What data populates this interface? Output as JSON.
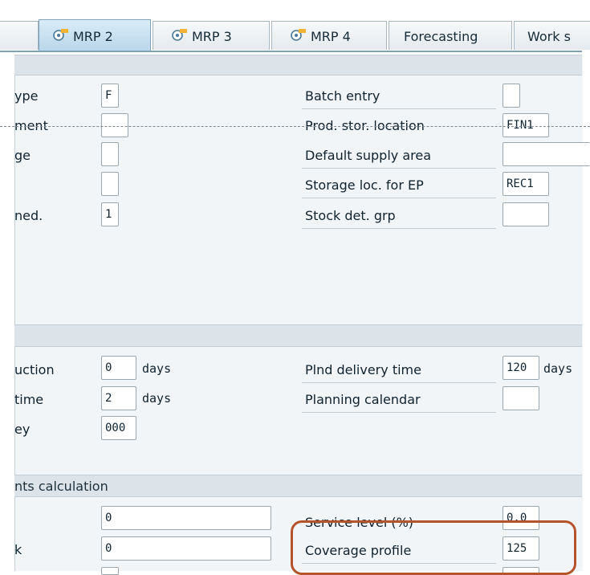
{
  "tabs": [
    {
      "label": "MRP 2",
      "icon": "mrp-icon",
      "active": true
    },
    {
      "label": "MRP 3",
      "icon": "mrp-icon",
      "active": false
    },
    {
      "label": "MRP 4",
      "icon": "mrp-icon",
      "active": false
    },
    {
      "label": "Forecasting",
      "icon": "",
      "active": false
    },
    {
      "label": "Work s",
      "icon": "",
      "active": false
    }
  ],
  "procurement": {
    "left": [
      {
        "label": "ype",
        "value": "F"
      },
      {
        "label": "ment",
        "value": ""
      },
      {
        "label": "ge",
        "value": ""
      },
      {
        "label": "",
        "value": ""
      },
      {
        "label": "ned.",
        "value": "1"
      }
    ],
    "right": [
      {
        "label": "Batch entry",
        "value": ""
      },
      {
        "label": "Prod. stor. location",
        "value": "FIN1"
      },
      {
        "label": "Default supply area",
        "value": ""
      },
      {
        "label": "Storage loc. for EP",
        "value": "REC1"
      },
      {
        "label": "Stock det. grp",
        "value": ""
      }
    ]
  },
  "scheduling": {
    "left": [
      {
        "label": "uction",
        "value": "0",
        "unit": "days"
      },
      {
        "label": "time",
        "value": "2",
        "unit": "days"
      },
      {
        "label": "ey",
        "value": "000",
        "unit": ""
      }
    ],
    "right": [
      {
        "label": "Plnd delivery time",
        "value": "120",
        "unit": "days"
      },
      {
        "label": "Planning calendar",
        "value": "",
        "unit": ""
      }
    ]
  },
  "net_requirements": {
    "header": "nts calculation",
    "left": [
      {
        "label": "",
        "value": "0"
      },
      {
        "label": "k",
        "value": "0"
      }
    ],
    "right": [
      {
        "label": "Service level (%)",
        "value": "0.0"
      },
      {
        "label": "Coverage profile",
        "value": "125"
      }
    ]
  }
}
